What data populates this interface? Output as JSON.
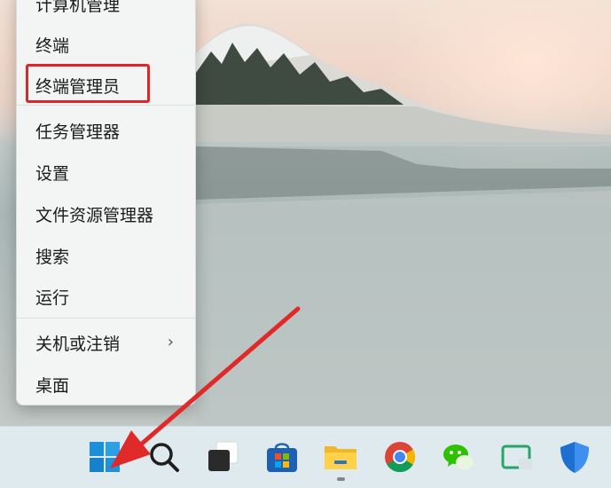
{
  "menu": {
    "items": [
      {
        "label": "计算机管理"
      },
      {
        "label": "终端"
      },
      {
        "label": "终端管理员"
      },
      {
        "label": "任务管理器"
      },
      {
        "label": "设置"
      },
      {
        "label": "文件资源管理器"
      },
      {
        "label": "搜索"
      },
      {
        "label": "运行"
      },
      {
        "label": "关机或注销",
        "chevron": "›"
      },
      {
        "label": "桌面"
      }
    ]
  },
  "taskbar": {
    "icons": [
      "windows-start-icon",
      "search-icon",
      "task-view-icon",
      "microsoft-store-icon",
      "file-explorer-icon",
      "chrome-icon",
      "wechat-icon",
      "screen-capture-icon",
      "windows-security-icon"
    ]
  },
  "colors": {
    "highlight": "#e0242a",
    "arrow": "#e02a2a",
    "taskbar": "#dfeaee",
    "menu": "#f3f4f4"
  }
}
